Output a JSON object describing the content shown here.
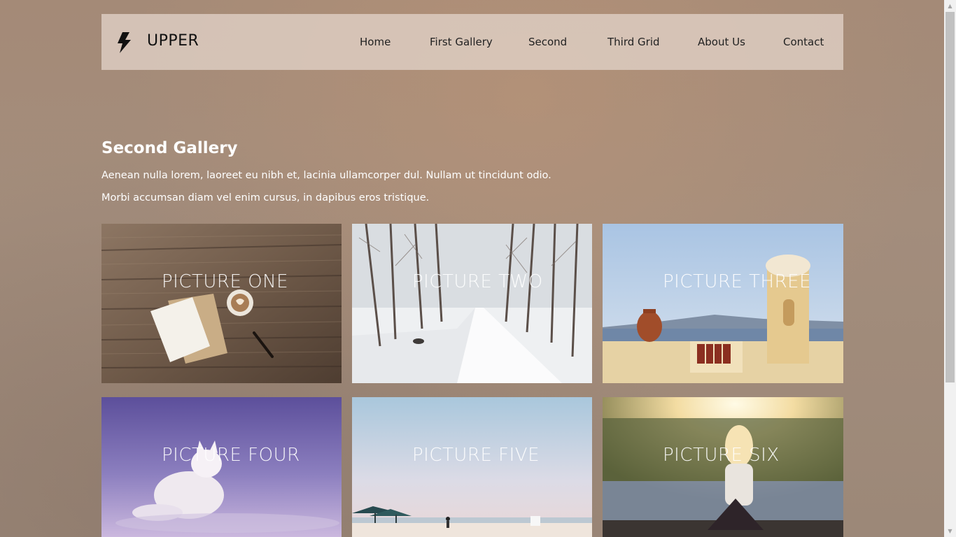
{
  "header": {
    "brand": "UPPER",
    "logo_icon": "lightning-bolt-icon",
    "nav": [
      "Home",
      "First Gallery",
      "Second",
      "Third Grid",
      "About Us",
      "Contact"
    ]
  },
  "intro": {
    "title": "Second Gallery",
    "line1": "Aenean nulla lorem, laoreet eu nibh et, lacinia ullamcorper dul. Nullam ut tincidunt odio.",
    "line2": "Morbi accumsan diam vel enim cursus, in dapibus eros tristique."
  },
  "gallery": [
    {
      "caption": "PICTURE ONE"
    },
    {
      "caption": "PICTURE TWO"
    },
    {
      "caption": "PICTURE THREE"
    },
    {
      "caption": "PICTURE FOUR"
    },
    {
      "caption": "PICTURE FIVE"
    },
    {
      "caption": "PICTURE SIX"
    }
  ]
}
